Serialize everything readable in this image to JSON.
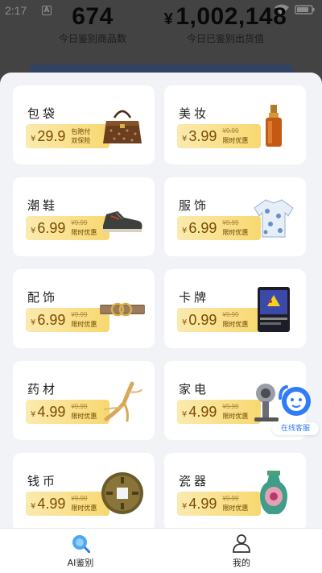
{
  "status_bar": {
    "time": "2:17",
    "notif_glyph": "A"
  },
  "stats": {
    "count_value": "674",
    "count_label": "今日鉴别商品数",
    "value_currency": "¥",
    "value_amount": "1,002,148",
    "value_label": "今日已鉴别出货值"
  },
  "categories": [
    {
      "title": "包袋",
      "currency": "¥",
      "price": "29.9",
      "old_price": "",
      "promo_line1": "包赔付",
      "promo_line2": "双保险",
      "icon": "handbag-icon"
    },
    {
      "title": "美妆",
      "currency": "¥",
      "price": "3.99",
      "old_price": "¥9.99",
      "promo_line1": "限时优惠",
      "promo_line2": "",
      "icon": "serum-bottle-icon"
    },
    {
      "title": "潮鞋",
      "currency": "¥",
      "price": "6.99",
      "old_price": "¥9.99",
      "promo_line1": "限时优惠",
      "promo_line2": "",
      "icon": "sneaker-icon"
    },
    {
      "title": "服饰",
      "currency": "¥",
      "price": "6.99",
      "old_price": "¥9.99",
      "promo_line1": "限时优惠",
      "promo_line2": "",
      "icon": "shirt-icon"
    },
    {
      "title": "配饰",
      "currency": "¥",
      "price": "6.99",
      "old_price": "¥9.99",
      "promo_line1": "限时优惠",
      "promo_line2": "",
      "icon": "belt-icon"
    },
    {
      "title": "卡牌",
      "currency": "¥",
      "price": "0.99",
      "old_price": "¥9.99",
      "promo_line1": "限时优惠",
      "promo_line2": "",
      "icon": "trading-card-icon"
    },
    {
      "title": "药材",
      "currency": "¥",
      "price": "4.99",
      "old_price": "¥9.99",
      "promo_line1": "限时优惠",
      "promo_line2": "",
      "icon": "ginseng-icon"
    },
    {
      "title": "家电",
      "currency": "¥",
      "price": "4.99",
      "old_price": "¥9.99",
      "promo_line1": "限时优惠",
      "promo_line2": "",
      "icon": "hair-dryer-icon"
    },
    {
      "title": "钱币",
      "currency": "¥",
      "price": "4.99",
      "old_price": "¥9.99",
      "promo_line1": "限时优惠",
      "promo_line2": "",
      "icon": "coin-icon"
    },
    {
      "title": "瓷器",
      "currency": "¥",
      "price": "4.99",
      "old_price": "¥9.99",
      "promo_line1": "限时优惠",
      "promo_line2": "",
      "icon": "vase-icon"
    }
  ],
  "service": {
    "label": "在线客服"
  },
  "tabbar": {
    "tabs": [
      {
        "label": "AI鉴别",
        "icon": "search-icon",
        "active": true
      },
      {
        "label": "我的",
        "icon": "person-icon",
        "active": false
      }
    ]
  },
  "colors": {
    "accent": "#2f7cf6",
    "price_tag_start": "#fbeab0",
    "price_tag_end": "#f7d870",
    "price_text": "#7a4b00"
  }
}
